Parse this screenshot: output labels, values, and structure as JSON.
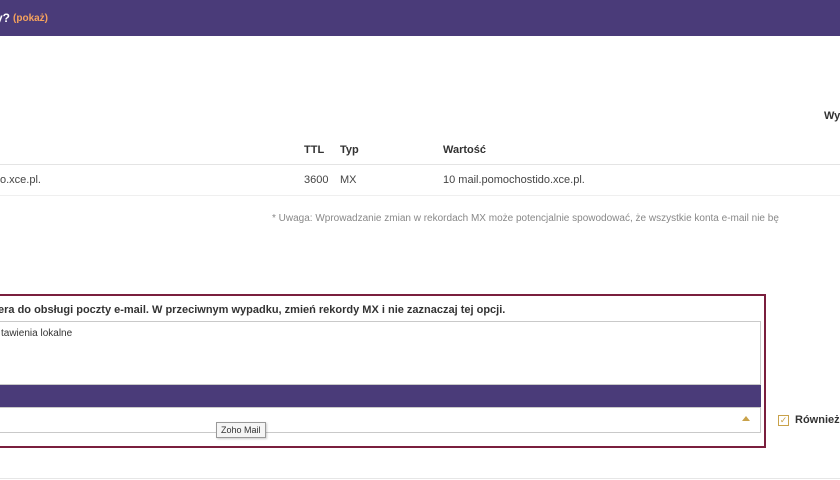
{
  "header": {
    "title": "y?",
    "link": "(pokaż)"
  },
  "top_right_label": "Wy",
  "table": {
    "headers": {
      "ttl": "TTL",
      "typ": "Typ",
      "wartosc": "Wartość"
    },
    "row": {
      "name": "o.xce.pl.",
      "ttl": "3600",
      "typ": "MX",
      "wartosc": "10 mail.pomochostido.xce.pl."
    }
  },
  "note": "* Uwaga: Wprowadzanie zmian w rekordach MX może potencjalnie spowodować, że wszystkie konta e-mail nie bę",
  "email_section": {
    "instruction": "era do obsługi poczty e-mail. W przeciwnym wypadku, zmień rekordy MX i nie zaznaczaj tej opcji.",
    "textarea_value": "tawienia lokalne",
    "tooltip": "Zoho Mail",
    "checkbox_label": "Również"
  },
  "colors": {
    "header_bg": "#4a3b79",
    "accent": "#f5a25d",
    "border": "#7a1f3d"
  }
}
